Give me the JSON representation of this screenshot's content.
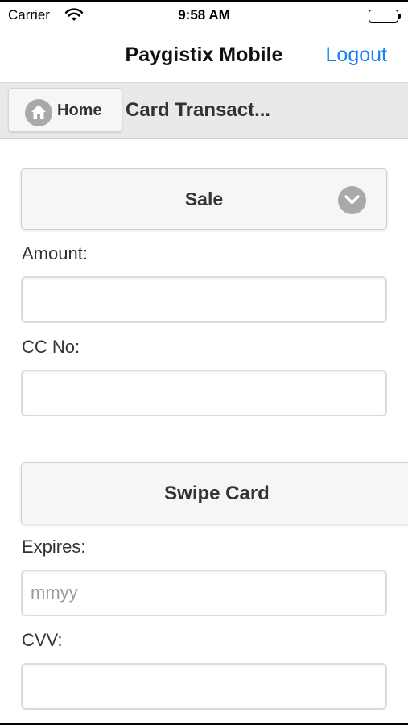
{
  "status_bar": {
    "carrier": "Carrier",
    "time": "9:58 AM",
    "battery_level": 1.0
  },
  "nav": {
    "title": "Paygistix Mobile",
    "logout_label": "Logout",
    "accent_color": "#1a7ff0"
  },
  "header": {
    "home_label": "Home",
    "title": "Card Transact..."
  },
  "form": {
    "transaction_type": "Sale",
    "amount_label": "Amount:",
    "amount_value": "",
    "cc_label": "CC No:",
    "cc_value": "",
    "swipe_label": "Swipe Card",
    "expires_label": "Expires:",
    "expires_placeholder": "mmyy",
    "cvv_label": "CVV:",
    "cvv_value": ""
  },
  "icons": {
    "wifi": "wifi-icon",
    "battery": "battery-icon",
    "home": "home-icon",
    "dropdown": "chevron-down-icon"
  }
}
